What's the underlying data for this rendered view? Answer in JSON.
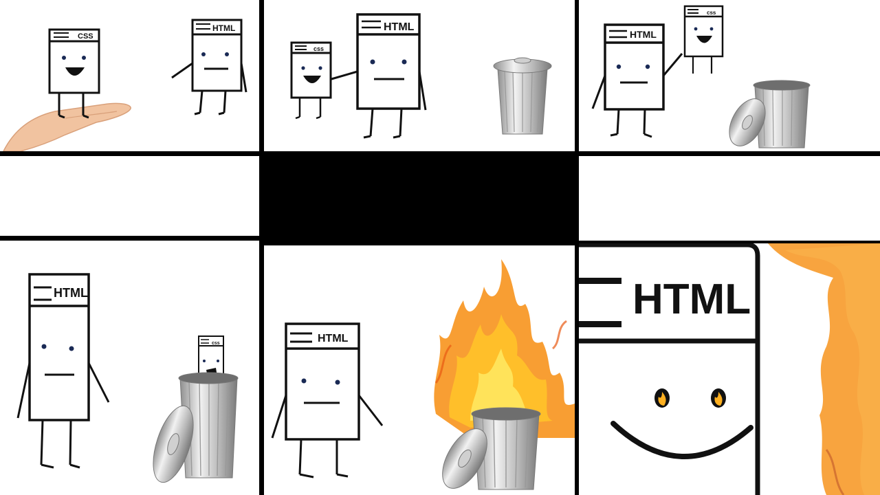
{
  "comic": {
    "labels": {
      "css": "CSS",
      "css_small": "css",
      "html": "HTML"
    },
    "colors": {
      "ink": "#111111",
      "paper": "#ffffff",
      "skin": "#f1c3a0",
      "can_light": "#e6e6e6",
      "can_dark": "#8f8f8f",
      "flame_yellow": "#ffd23a",
      "flame_orange": "#f7941d",
      "flame_red": "#e85a12"
    },
    "panels": [
      {
        "id": "p1",
        "content": "CSS page held in a hand, HTML page reaches toward it"
      },
      {
        "id": "p2",
        "content": "HTML page holds CSS page, trash can nearby"
      },
      {
        "id": "p3",
        "content": "HTML page holds CSS page over open trash can"
      },
      {
        "id": "p4",
        "content": "empty white panel"
      },
      {
        "id": "p5",
        "content": "black panel"
      },
      {
        "id": "p6",
        "content": "empty white panel"
      },
      {
        "id": "p7",
        "content": "CSS page inside the trash can"
      },
      {
        "id": "p8",
        "content": "trash can on fire"
      },
      {
        "id": "p9",
        "content": "close-up of HTML smiling with fire in its eyes"
      }
    ]
  }
}
